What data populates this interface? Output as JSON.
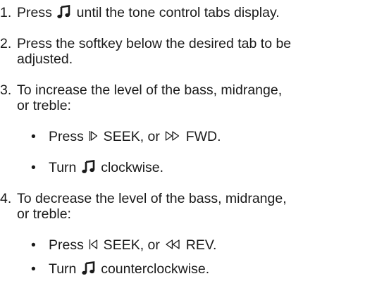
{
  "steps": [
    {
      "number": "1.",
      "text_before": "Press ",
      "icon": "music-note-icon",
      "text_after": " until the tone control tabs display."
    },
    {
      "number": "2.",
      "line1": "Press the softkey below the desired tab to be",
      "line2": "adjusted."
    },
    {
      "number": "3.",
      "line1": "To increase the level of the bass, midrange,",
      "line2": "or treble:",
      "bullets": [
        {
          "bullet": "•",
          "text_before": "Press ",
          "icon1": "seek-forward-icon",
          "middle": " SEEK, or ",
          "icon2": "fast-forward-icon",
          "text_after": " FWD."
        },
        {
          "bullet": "•",
          "text_before": "Turn ",
          "icon1": "music-note-icon",
          "text_after": " clockwise."
        }
      ]
    },
    {
      "number": "4.",
      "line1": "To decrease the level of the bass, midrange,",
      "line2": "or treble:",
      "bullets": [
        {
          "bullet": "•",
          "text_before": "Press ",
          "icon1": "seek-back-icon",
          "middle": " SEEK, or ",
          "icon2": "rewind-icon",
          "text_after": " REV."
        },
        {
          "bullet": "•",
          "text_before": "Turn ",
          "icon1": "music-note-icon",
          "text_after": " counterclockwise."
        }
      ]
    }
  ]
}
